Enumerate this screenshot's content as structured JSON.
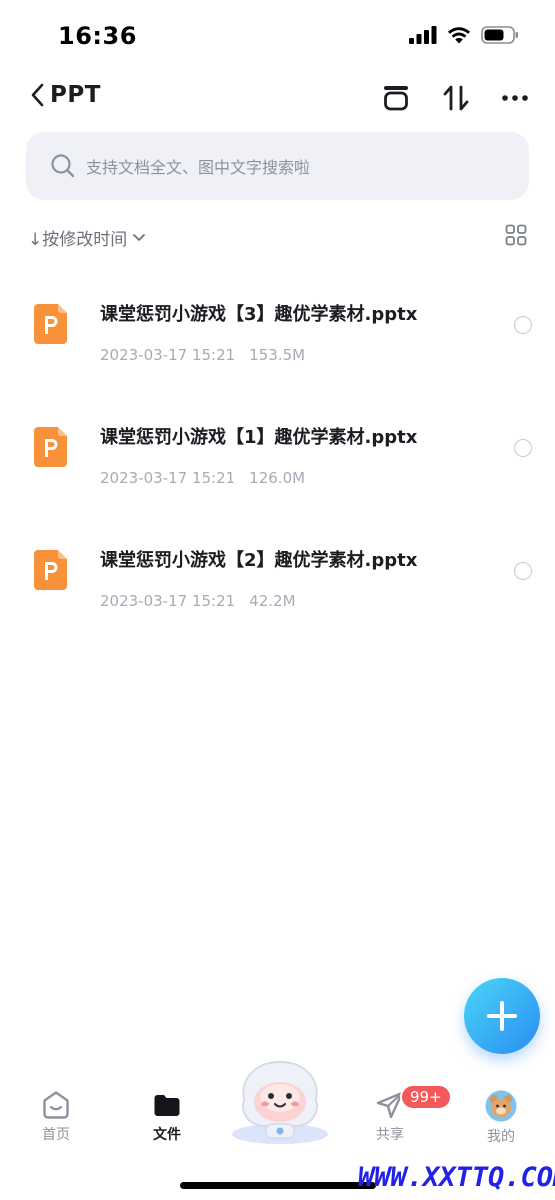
{
  "status_bar": {
    "time": "16:36"
  },
  "nav": {
    "back_label": "PPT"
  },
  "search": {
    "placeholder": "支持文档全文、图中文字搜索啦"
  },
  "sort": {
    "label": "↓按修改时间"
  },
  "files": [
    {
      "name": "课堂惩罚小游戏【3】趣优学素材.pptx",
      "date": "2023-03-17 15:21",
      "size": "153.5M"
    },
    {
      "name": "课堂惩罚小游戏【1】趣优学素材.pptx",
      "date": "2023-03-17 15:21",
      "size": "126.0M"
    },
    {
      "name": "课堂惩罚小游戏【2】趣优学素材.pptx",
      "date": "2023-03-17 15:21",
      "size": "42.2M"
    }
  ],
  "file_icon": {
    "letter": "P",
    "color": "#f7923a"
  },
  "tabs": [
    {
      "label": "首页",
      "icon": "home-icon"
    },
    {
      "label": "文件",
      "icon": "folder-icon"
    },
    {
      "label": "共享",
      "icon": "send-icon",
      "badge": "99+"
    },
    {
      "label": "我的",
      "icon": "avatar-icon"
    }
  ],
  "colors": {
    "accent": "#2a8cf2",
    "badge": "#f25a5a"
  },
  "watermark": "WWW.XXTTQ.COM"
}
